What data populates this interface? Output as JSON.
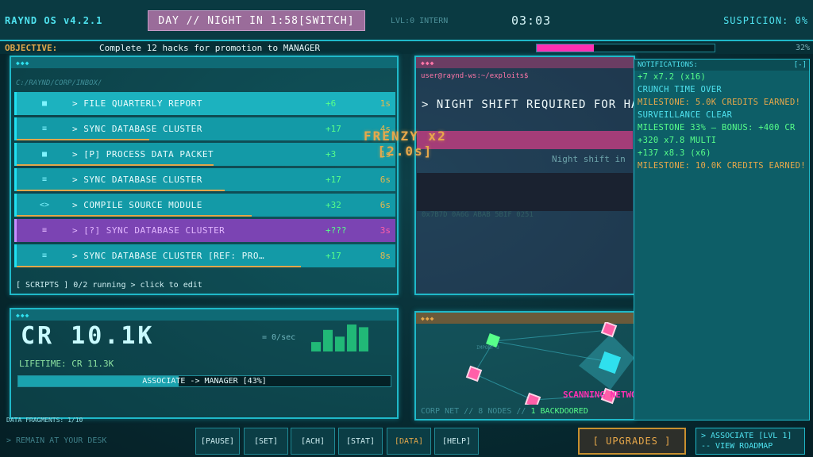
{
  "top": {
    "os_name": "RAYND OS v4.2.1",
    "daynight_prefix": "DAY // NIGHT IN 1:58 ",
    "daynight_switch": "[SWITCH]",
    "level": "LVL:0 INTERN",
    "clock": "03:03",
    "suspicion": "SUSPICION: 0%"
  },
  "objective": {
    "label": "OBJECTIVE:",
    "text": "Complete 12 hacks for promotion to MANAGER",
    "progress": 32,
    "progress_label": "32%"
  },
  "inbox": {
    "path": "C:/RAYND/CORP/INBOX/",
    "tasks": [
      {
        "icon": "■",
        "name": "> FILE QUARTERLY REPORT",
        "reward": "+6",
        "time": "1s",
        "progress": 0
      },
      {
        "icon": "≡",
        "name": "> SYNC DATABASE CLUSTER",
        "reward": "+17",
        "time": "4s",
        "progress": 0.35
      },
      {
        "icon": "■",
        "name": "> [P] PROCESS DATA PACKET",
        "reward": "+3",
        "time": "1s",
        "progress": 0.52
      },
      {
        "icon": "≡",
        "name": "> SYNC DATABASE CLUSTER",
        "reward": "+17",
        "time": "6s",
        "progress": 0.55
      },
      {
        "icon": "<>",
        "name": "> COMPILE SOURCE MODULE",
        "reward": "+32",
        "time": "6s",
        "progress": 0.62
      },
      {
        "icon": "≡",
        "name": "> [?] SYNC DATABASE CLUSTER",
        "reward": "+???",
        "time": "3s",
        "progress": 0
      },
      {
        "icon": "≡",
        "name": "> SYNC DATABASE CLUSTER [REF: PRO…",
        "reward": "+17",
        "time": "8s",
        "progress": 0.75
      }
    ],
    "scripts": "[ SCRIPTS ] 0/2 running  > click to edit"
  },
  "credits": {
    "value": "CR 10.1K",
    "per_sec": "= 0/sec",
    "lifetime": "LIFETIME: CR 11.3K",
    "rank": "ASSOCIATE -> MANAGER  [43%]",
    "rank_progress": 43,
    "spark": [
      0.35,
      0.8,
      0.55,
      1.0,
      0.9
    ]
  },
  "terminal": {
    "prompt": "user@raynd-ws:~/exploits$",
    "command": "> NIGHT SHIFT REQUIRED FOR HACK",
    "sub": "Night shift in",
    "hex": "0x7B7D  0A6G ABAB 5BIF 0251"
  },
  "frenzy": {
    "label": "FRENZY x2",
    "timer": "[2.0s]"
  },
  "notifications": {
    "title": "NOTIFICATIONS:",
    "close": "[-]",
    "items": [
      {
        "text": "+7 x7.2 (x16)",
        "color": "#57ff8a"
      },
      {
        "text": "CRUNCH TIME OVER",
        "color": "#4fe3f0"
      },
      {
        "text": "MILESTONE: 5.0K CREDITS EARNED!",
        "color": "#e8a84a"
      },
      {
        "text": "SURVEILLANCE CLEAR",
        "color": "#4fe3f0"
      },
      {
        "text": "MILESTONE 33% — BONUS: +400 CR",
        "color": "#57ff8a"
      },
      {
        "text": "+320 x7.8 MULTI",
        "color": "#57ff8a"
      },
      {
        "text": "+137 x8.3 (x6)",
        "color": "#57ff8a"
      },
      {
        "text": "MILESTONE: 10.0K CREDITS EARNED!",
        "color": "#e8a84a"
      }
    ]
  },
  "network": {
    "status_prefix": "CORP NET // 8 NODES // ",
    "status_backdoored": "1 BACKDOORED",
    "scanning": "SCANNING NETWORK",
    "node_label": "IMPORT 3"
  },
  "footer": {
    "fragments": "DATA FRAGMENTS: 1/10",
    "remain": "> REMAIN AT YOUR DESK",
    "buttons": [
      "[PAUSE]",
      "[SET]",
      "[ACH]",
      "[STAT]",
      "[DATA]",
      "[HELP]"
    ],
    "upgrades": "[ UPGRADES ]",
    "roadmap": "> ASSOCIATE [LVL 1] -- VIEW ROADMAP"
  }
}
